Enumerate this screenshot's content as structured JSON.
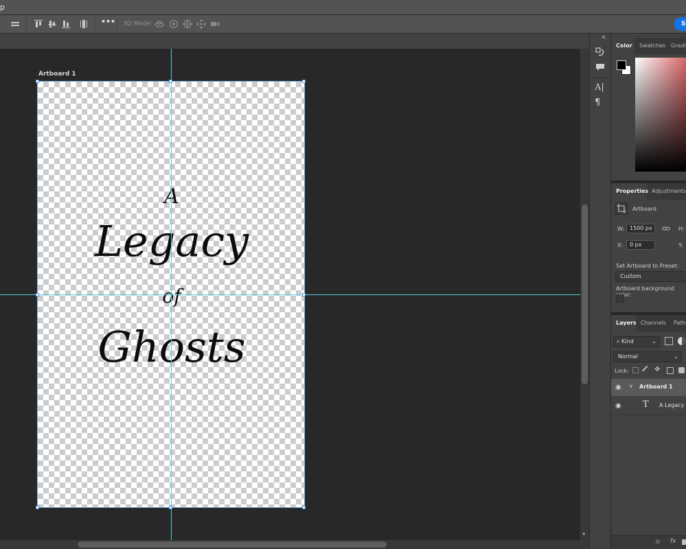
{
  "menubar": {
    "text": "p"
  },
  "options_bar": {
    "mode3d_label": "3D Mode:",
    "more_glyph": "•••",
    "share_label": "Sh"
  },
  "document": {
    "artboard_label": "Artboard 1",
    "title_lines": [
      "A",
      "Legacy",
      "of",
      "Ghosts"
    ]
  },
  "icon_column": {
    "collapse_glyph": "«"
  },
  "color_panel": {
    "tabs": [
      "Color",
      "Swatches",
      "Gradie"
    ],
    "active_tab": "Color",
    "foreground": "#000000",
    "background": "#ffffff"
  },
  "properties_panel": {
    "tabs": [
      "Properties",
      "Adjustments"
    ],
    "active_tab": "Properties",
    "item_label": "Artboard",
    "width_label": "W:",
    "width_value": "1500 px",
    "height_label": "H:",
    "x_label": "X:",
    "x_value": "0 px",
    "y_label": "Y:",
    "preset_label": "Set Artboard to Preset:",
    "preset_value": "Custom",
    "bg_color_label": "Artboard background color:"
  },
  "layers_panel": {
    "tabs": [
      "Layers",
      "Channels",
      "Paths"
    ],
    "active_tab": "Layers",
    "filter_value": "Kind",
    "blend_mode": "Normal",
    "lock_label": "Lock:",
    "layers": [
      {
        "name": "Artboard 1",
        "type": "artboard",
        "visible": true
      },
      {
        "name": "A Legacy of",
        "type": "text",
        "visible": true
      }
    ],
    "bottom_fx": "fx",
    "type_glyph": "T",
    "eye_glyph": "◉",
    "expand_glyph": "∨"
  },
  "colors": {
    "accent": "#1473e6",
    "guide": "#4dd2e4",
    "artboard_border": "#7ab6e6",
    "canvas_bg": "#282828",
    "panel_bg": "#424242"
  }
}
